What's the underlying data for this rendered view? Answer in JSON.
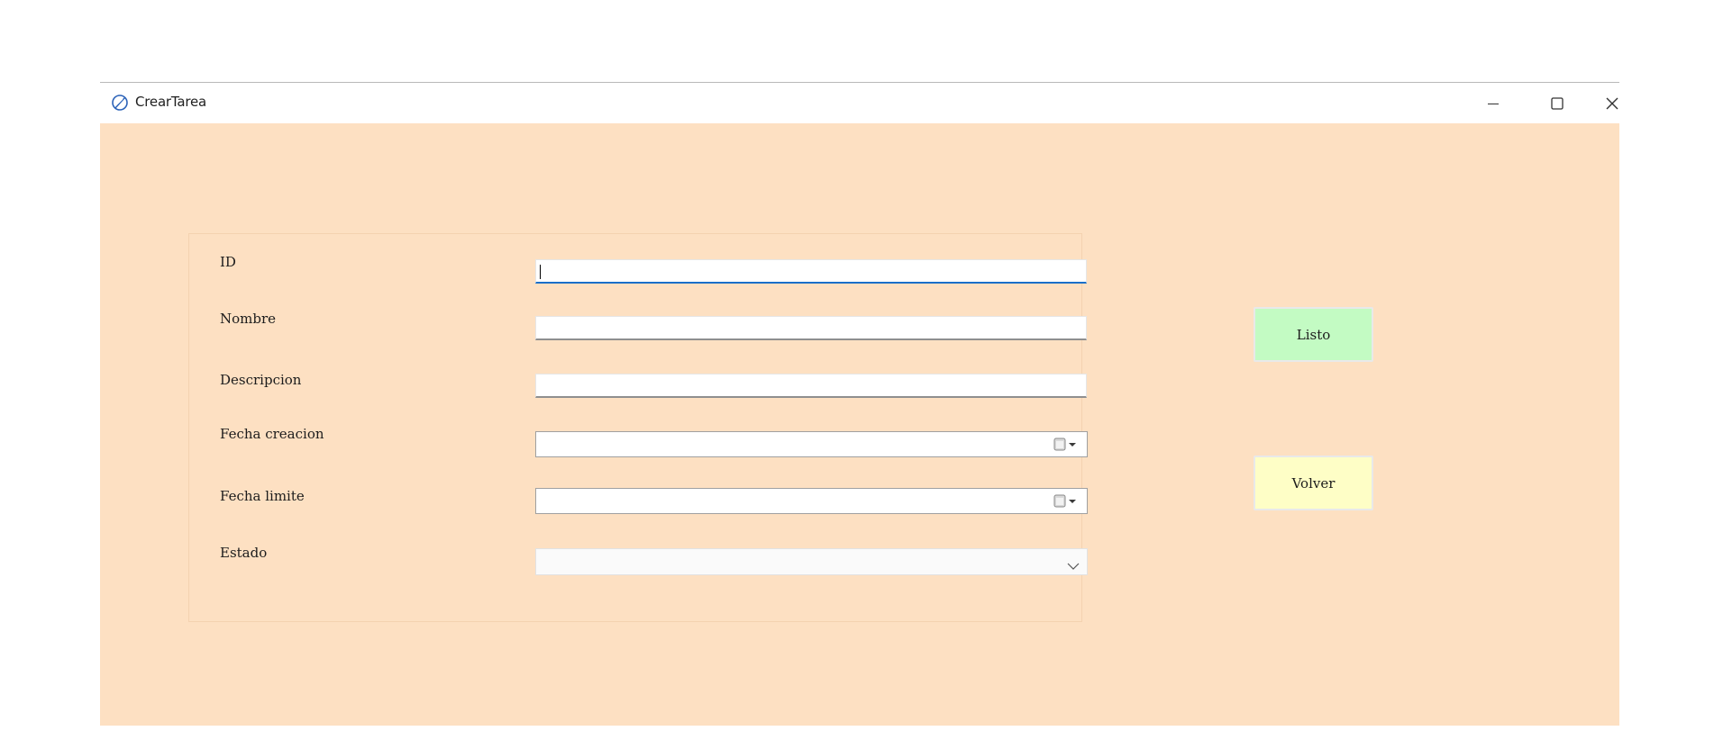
{
  "window": {
    "title": "CrearTarea",
    "icon": "app-feather-icon",
    "controls": [
      "minimize-icon",
      "maximize-icon",
      "close-icon"
    ]
  },
  "form": {
    "fields": [
      {
        "label": "ID",
        "type": "text",
        "value": ""
      },
      {
        "label": "Nombre",
        "type": "text",
        "value": ""
      },
      {
        "label": "Descripcion",
        "type": "text",
        "value": ""
      },
      {
        "label": "Fecha creacion",
        "type": "date",
        "value": ""
      },
      {
        "label": "Fecha limite",
        "type": "date",
        "value": ""
      },
      {
        "label": "Estado",
        "type": "select",
        "value": ""
      }
    ]
  },
  "actions": {
    "listo_label": "Listo",
    "volver_label": "Volver"
  },
  "colors": {
    "background": "#fde0c2",
    "listo_button": "#c3fbc3",
    "volver_button": "#fefec6",
    "focus_accent": "#1a6fc9"
  }
}
